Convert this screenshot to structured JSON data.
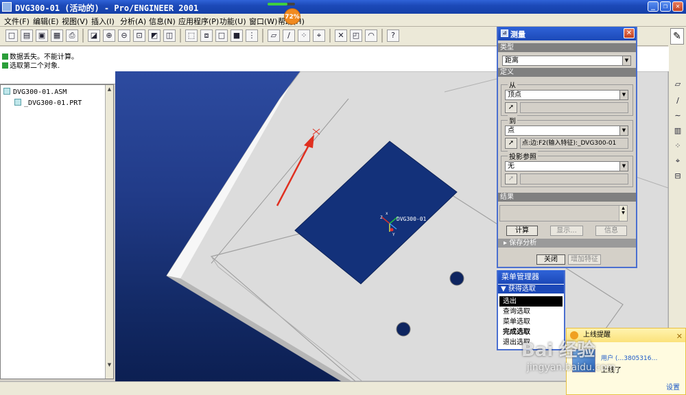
{
  "window": {
    "title": "DVG300-01 (活动的) - Pro/ENGINEER 2001",
    "progress_badge": "72%",
    "progress_fraction": 0.72
  },
  "menu": [
    "文件(F)",
    "编辑(E)",
    "视图(V)",
    "插入(I)",
    "分析(A)",
    "信息(N)",
    "应用程序(P)",
    "功能(U)",
    "窗口(W)",
    "帮助(H)"
  ],
  "messages": [
    {
      "text": "数据丢失。不能计算。",
      "icon": "warning-icon",
      "color": "#2b9e3a"
    },
    {
      "text": "选取第二个对象.",
      "icon": "arrow-right-icon",
      "color": "#2b9e3a"
    }
  ],
  "tree": {
    "items": [
      {
        "label": "DVG300-01.ASM"
      },
      {
        "label": "_DVG300-01.PRT"
      }
    ]
  },
  "viewport": {
    "model_label": "DVG300-01",
    "axis_labels": {
      "x": "x",
      "y": "Y",
      "z": "Z"
    },
    "colors": {
      "accent": "#e03020",
      "part": "#e4e4e4"
    }
  },
  "measure": {
    "title": "测量",
    "type_label": "类型",
    "type_value": "距离",
    "definition_label": "定义",
    "from_label": "从",
    "from_value": "顶点",
    "from_field": "",
    "to_label": "到",
    "to_value": "点",
    "to_field": "点:边:F2(输入特征):_DVG300-01",
    "proj_label": "投影参照",
    "proj_value": "无",
    "proj_field": "",
    "result_label": "结果",
    "buttons": {
      "compute": "计算",
      "display": "显示...",
      "info": "信息",
      "close": "关闭",
      "add_feature": "增加特征"
    },
    "save_analysis": "保存分析"
  },
  "menu_manager": {
    "title": "菜单管理器",
    "subtitle": "获得选取",
    "items": [
      {
        "label": "选出",
        "selected": true,
        "bold": false
      },
      {
        "label": "查询选取",
        "selected": false,
        "bold": false
      },
      {
        "label": "菜单选取",
        "selected": false,
        "bold": false
      },
      {
        "label": "完成选取",
        "selected": false,
        "bold": true
      },
      {
        "label": "退出选取",
        "selected": false,
        "bold": false
      }
    ]
  },
  "notification": {
    "title": "上线提醒",
    "link": "用户 (…3805316…",
    "body": "上线了",
    "settings": "设置"
  },
  "watermark": {
    "big": "Bai 经验",
    "small": "jingyan.baidu.com"
  }
}
